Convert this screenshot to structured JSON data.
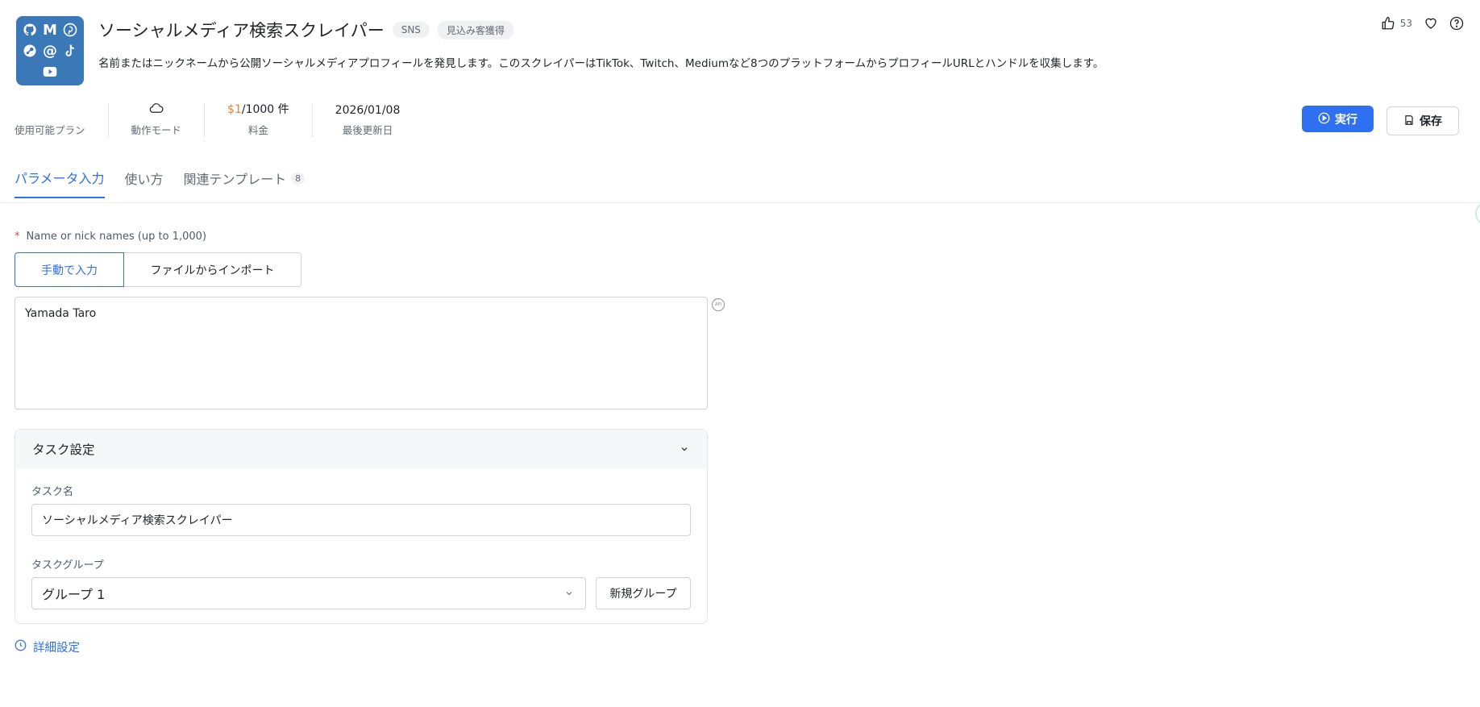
{
  "app": {
    "icon_glyphs": [
      "github-icon",
      "medium-icon",
      "pinterest-icon",
      "steam-icon",
      "at-icon",
      "tiktok-icon",
      "youtube-icon"
    ],
    "title": "ソーシャルメディア検索スクレイパー",
    "tags": [
      "SNS",
      "見込み客獲得"
    ],
    "description": "名前またはニックネームから公開ソーシャルメディアプロフィールを発見します。このスクレイパーはTikTok、Twitch、Mediumなど8つのプラットフォームからプロフィールURLとハンドルを収集します。",
    "like_count": "53"
  },
  "stats": {
    "plan_label": "使用可能プラン",
    "mode_label": "動作モード",
    "price_accent": "$1",
    "price_rest": "/1000 件",
    "price_label": "料金",
    "updated_value": "2026/01/08",
    "updated_label": "最後更新日"
  },
  "actions": {
    "run_label": "実行",
    "save_label": "保存"
  },
  "tabs": [
    {
      "label": "パラメータ入力",
      "active": true
    },
    {
      "label": "使い方",
      "active": false
    },
    {
      "label": "関連テンプレート",
      "count": "8",
      "active": false
    }
  ],
  "form": {
    "names_label": "Name or nick names (up to 1,000)",
    "required_mark": "*",
    "input_modes": [
      "手動で入力",
      "ファイルからインポート"
    ],
    "names_value": "Yamada Taro",
    "api_badge": "API"
  },
  "task": {
    "section_title": "タスク設定",
    "name_label": "タスク名",
    "name_value": "ソーシャルメディア検索スクレイパー",
    "group_label": "タスクグループ",
    "group_value": "グループ 1",
    "new_group_label": "新規グループ"
  },
  "advanced_label": "詳細設定",
  "colors": {
    "accent": "#2f6ff2",
    "price_accent": "#e8833a",
    "icon_bg": "#3a78b8"
  }
}
